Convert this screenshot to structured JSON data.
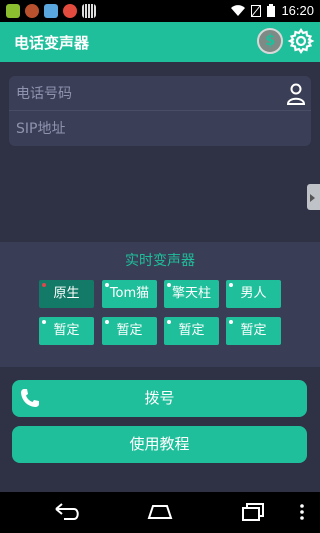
{
  "status_bar": {
    "time": "16:20"
  },
  "app_bar": {
    "title": "电话变声器"
  },
  "inputs": {
    "phone_placeholder": "电话号码",
    "sip_placeholder": "SIP地址"
  },
  "voice_changer": {
    "title": "实时变声器",
    "row1": [
      {
        "label": "原生",
        "selected": true
      },
      {
        "label": "Tom猫",
        "selected": false
      },
      {
        "label": "擎天柱",
        "selected": false
      },
      {
        "label": "男人",
        "selected": false
      }
    ],
    "row2": [
      {
        "label": "暂定"
      },
      {
        "label": "暂定"
      },
      {
        "label": "暂定"
      },
      {
        "label": "暂定"
      }
    ]
  },
  "actions": {
    "dial_label": "拨号",
    "tutorial_label": "使用教程"
  },
  "colors": {
    "accent": "#1fbf9b",
    "selected": "#127a66",
    "background": "#2f3145"
  },
  "icons": {
    "settings": "gear-icon",
    "coin": "coin-icon",
    "contact": "contact-icon",
    "phone": "phone-icon"
  }
}
